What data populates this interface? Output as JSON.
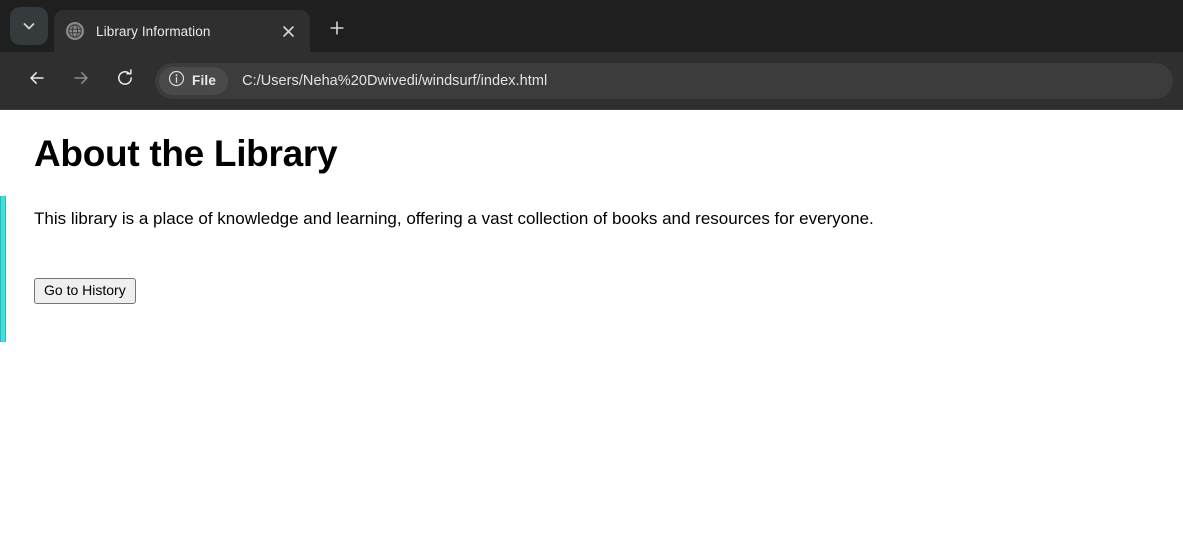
{
  "browser": {
    "tabstrip": {
      "tab_list_icon": "chevron-down-icon",
      "tabs": [
        {
          "title": "Library Information",
          "favicon": "globe-icon",
          "close_icon": "close-icon",
          "active": true
        }
      ],
      "new_tab_icon": "plus-icon",
      "new_tab_label": "+"
    },
    "toolbar": {
      "back_icon": "back-arrow-icon",
      "forward_icon": "forward-arrow-icon",
      "reload_icon": "reload-icon",
      "omnibox": {
        "site_info_icon": "info-circle-icon",
        "scheme_label": "File",
        "url": "C:/Users/Neha%20Dwivedi/windsurf/index.html"
      }
    }
  },
  "page": {
    "heading": "About the Library",
    "paragraph": "This library is a place of knowledge and learning, offering a vast collection of books and resources for everyone.",
    "button_label": "Go to History",
    "accent_color": "#40e0e0"
  }
}
